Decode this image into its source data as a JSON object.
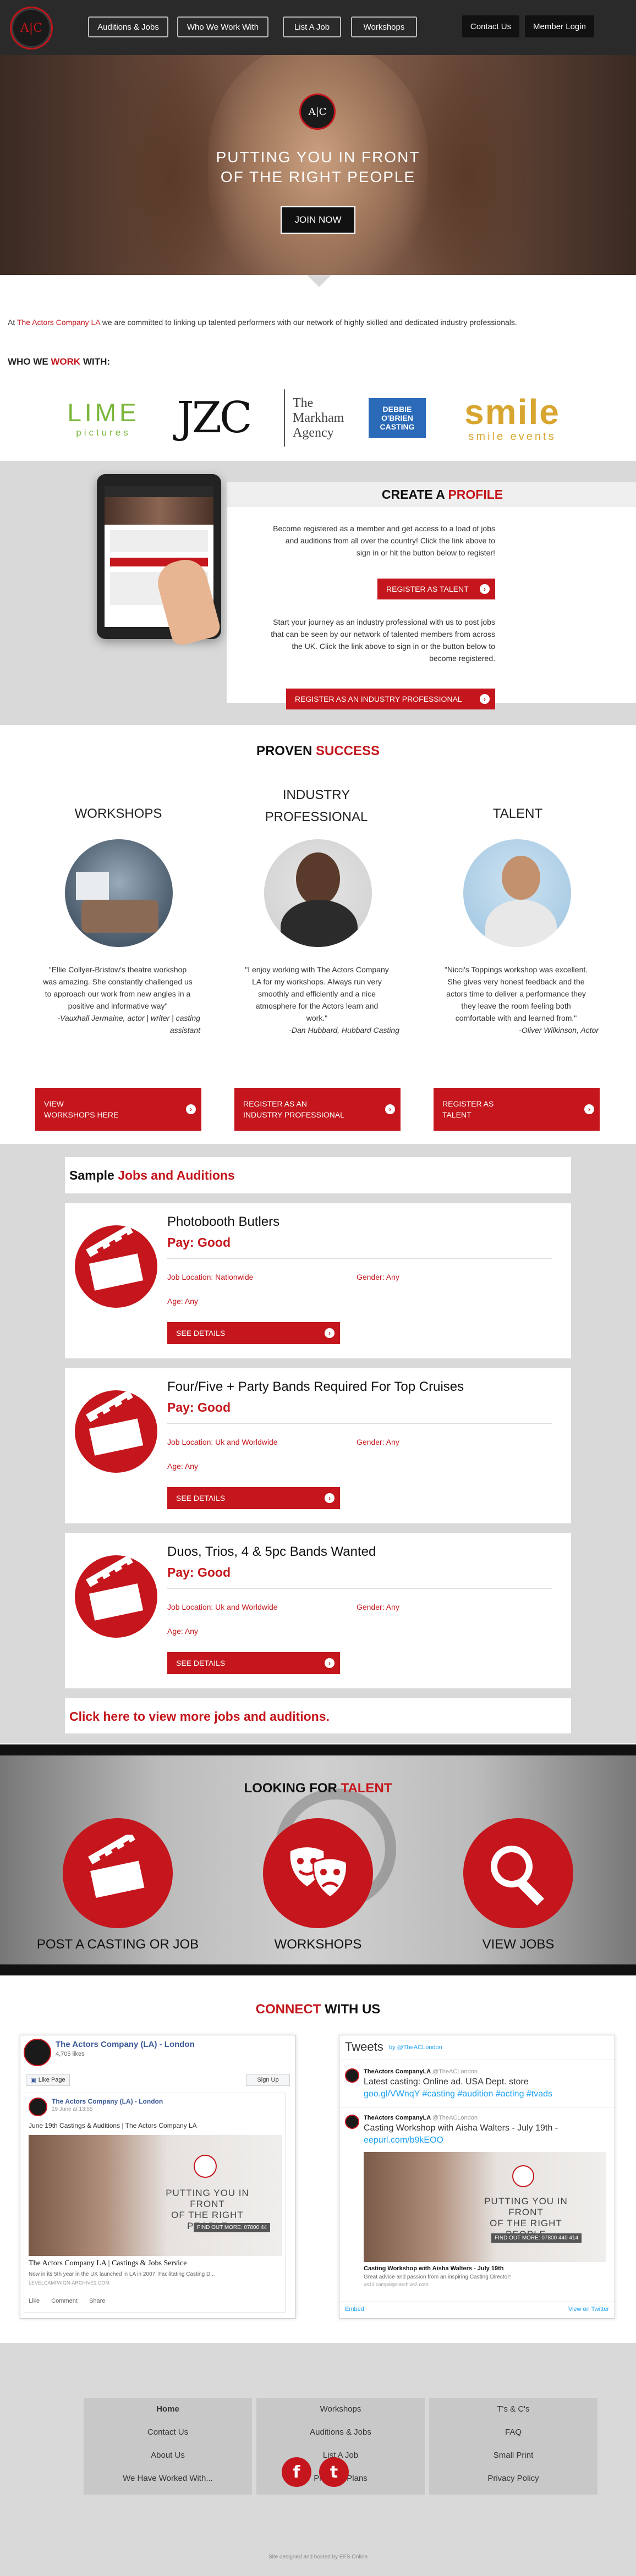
{
  "header": {
    "logo_text": "A|C",
    "nav": [
      "Auditions & Jobs",
      "Who We Work With",
      "List A Job",
      "Workshops"
    ],
    "contact": "Contact Us",
    "login": "Member Login"
  },
  "hero": {
    "title_line1": "PUTTING YOU IN FRONT",
    "title_line2": "OF THE RIGHT PEOPLE",
    "join": "JOIN NOW"
  },
  "intro": {
    "pre": "At ",
    "company": "The Actors Company LA",
    "post": " we are committed to linking up talented performers with our network of highly skilled and dedicated industry professionals."
  },
  "who": {
    "pre": "WHO WE ",
    "accent": "WORK",
    "post": " WITH:"
  },
  "partners": {
    "lime_1": "LIME",
    "lime_2": "pictures",
    "jzc": "JZC",
    "markham_1": "The",
    "markham_2": "Markham",
    "markham_3": "Agency",
    "debbie_1": "DEBBIE",
    "debbie_2": "O'BRIEN",
    "debbie_3": "CASTING",
    "smile_1": "smile",
    "smile_2": "smile events"
  },
  "profile": {
    "title_pre": "CREATE A ",
    "title_accent": "PROFILE",
    "text1_l1": "Become registered as a member and get access to a load of jobs",
    "text1_l2": "and auditions from all over the country! Click the link above to",
    "text1_l3": "sign in or hit the button below to register!",
    "btn1": "REGISTER AS TALENT",
    "text2_l1": "Start your journey as an industry professional with us to post jobs",
    "text2_l2": "that can be seen by our network of talented members from across",
    "text2_l3": "the UK. Click the link above to sign in or the button below to",
    "text2_l4": "become registered.",
    "btn2": "REGISTER AS AN INDUSTRY PROFESSIONAL"
  },
  "proven": {
    "title_pre": "PROVEN ",
    "title_accent": "SUCCESS",
    "col1": {
      "head": "WORKSHOPS",
      "q1": "\"Ellie Collyer-Bristow's theatre workshop",
      "q2": "was amazing. She constantly challenged us",
      "q3": "to approach our work from new angles in a",
      "q4": "positive and informative way\"",
      "q5": "-Vauxhall Jermaine, actor | writer | casting",
      "q6": "assistant",
      "btn_l1": "VIEW",
      "btn_l2": "WORKSHOPS HERE"
    },
    "col2": {
      "head_l1": "INDUSTRY",
      "head_l2": "PROFESSIONAL",
      "q1": "\"I enjoy working with The Actors Company",
      "q2": "LA for my workshops. Always run very",
      "q3": "smoothly and efficiently and a nice",
      "q4": "atmosphere for the Actors learn and",
      "q5": "work.\"",
      "q6": "-Dan Hubbard, Hubbard Casting",
      "btn_l1": "REGISTER AS AN",
      "btn_l2": "INDUSTRY PROFESSIONAL"
    },
    "col3": {
      "head": "TALENT",
      "q1": "\"Nicci's Toppings workshop was excellent.",
      "q2": "She gives very honest feedback and the",
      "q3": "actors time to deliver a performance they",
      "q4": "they leave the room feeling both",
      "q5": "comfortable with and learned from.\"",
      "q6": "-Oliver Wilkinson, Actor",
      "btn_l1": "REGISTER AS",
      "btn_l2": "TALENT"
    }
  },
  "jobs": {
    "heading_pre": "Sample ",
    "heading_accent": "Jobs and Auditions",
    "items": [
      {
        "title": "Photobooth Butlers",
        "pay": "Pay: Good",
        "location": "Job Location: Nationwide",
        "gender": "Gender: Any",
        "age": "Age: Any",
        "btn": "SEE DETAILS"
      },
      {
        "title": "Four/Five + Party Bands Required For Top Cruises",
        "pay": "Pay: Good",
        "location": "Job Location: Uk and Worldwide",
        "gender": "Gender: Any",
        "age": "Age: Any",
        "btn": "SEE DETAILS"
      },
      {
        "title": "Duos, Trios, 4 & 5pc Bands Wanted",
        "pay": "Pay: Good",
        "location": "Job Location: Uk and Worldwide",
        "gender": "Gender: Any",
        "age": "Age: Any",
        "btn": "SEE DETAILS"
      }
    ],
    "more": "Click here to view more jobs and auditions."
  },
  "looking": {
    "title_pre": "LOOKING FOR ",
    "title_accent": "TALENT",
    "items": [
      "POST A CASTING OR JOB",
      "WORKSHOPS",
      "VIEW JOBS"
    ]
  },
  "connect": {
    "title_pre": "CONNECT",
    "title_post": " WITH US",
    "fb": {
      "page": "The Actors Company (LA) - London",
      "likes": "4,705 likes",
      "like_btn": "Like Page",
      "signup": "Sign Up",
      "post_author": "The Actors Company (LA) - London",
      "post_date": "19 June at 13:55",
      "post_text": "June 19th Castings & Auditions | The Actors Company LA",
      "img_l1": "PUTTING YOU IN FRONT",
      "img_l2": "OF THE RIGHT PEOPLE",
      "img_find": "FIND OUT MORE: 07800 44",
      "card_title": "The Actors Company LA | Castings & Jobs Service",
      "card_desc": "Now in its 5th year in the UK launched in LA in 2007. Facilitating Casting D...",
      "card_url": "LEVELCAMPAIGN-ARCHIVE1.COM",
      "like": "Like",
      "comment": "Comment",
      "share": "Share"
    },
    "tw": {
      "title": "Tweets",
      "by": "by @TheACLondon",
      "t1_author": "TheActors CompanyLA",
      "t1_handle": "@TheACLondon",
      "t1_l1": "Latest casting: Online ad. USA Dept. store",
      "t1_l2": "goo.gl/VWnqY #casting #audition #acting #tvads",
      "t2_author": "TheActors CompanyLA",
      "t2_handle": "@TheACLondon",
      "t2_l1": "Casting Workshop with Aisha Walters - July 19th -",
      "t2_l2": "eepurl.com/b9kEOO",
      "img_l1": "PUTTING YOU IN FRONT",
      "img_l2": "OF THE RIGHT PEOPLE",
      "img_find": "FIND OUT MORE: 07800 440 414",
      "card_title": "Casting Workshop with Aisha Walters - July 19th",
      "card_desc": "Great advice and passion from an inspiring Casting Director!",
      "card_url": "us13.campaign-archive2.com",
      "embed": "Embed",
      "view": "View on Twitter"
    }
  },
  "footer": {
    "col1": [
      "Home",
      "Contact Us",
      "About Us",
      "We Have Worked With..."
    ],
    "col2": [
      "Workshops",
      "Auditions & Jobs",
      "List A Job",
      "Prices & Plans"
    ],
    "col3": [
      "T's & C's",
      "FAQ",
      "Small Print",
      "Privacy Policy"
    ],
    "credit": "Site designed and hosted by EFS Online",
    "fb_glyph": "f",
    "tw_glyph": "t"
  },
  "colors": {
    "accent": "#c4161c",
    "dark": "#2a2a2a",
    "grey": "#d9d9d9"
  }
}
